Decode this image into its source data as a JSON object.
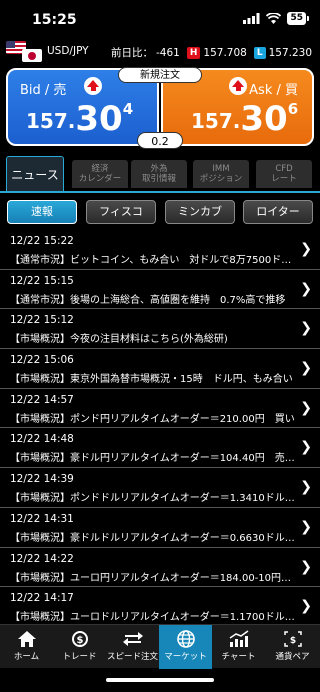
{
  "status": {
    "time": "15:25",
    "battery": "55"
  },
  "pair": {
    "name": "USD/JPY",
    "change_label": "前日比：",
    "change_value": "-461",
    "high_badge": "H",
    "high": "157.708",
    "low_badge": "L",
    "low": "157.230"
  },
  "bid": {
    "label": "Bid / 売",
    "prefix": "157.",
    "main": "30",
    "last": "4"
  },
  "ask": {
    "label": "Ask / 買",
    "prefix": "157.",
    "main": "30",
    "last": "6"
  },
  "new_order": "新規注文",
  "spread": "0.2",
  "tabs": [
    {
      "line1": "ニュース",
      "line2": ""
    },
    {
      "line1": "経済",
      "line2": "カレンダー"
    },
    {
      "line1": "外為",
      "line2": "取引情報"
    },
    {
      "line1": "IMM",
      "line2": "ポジション"
    },
    {
      "line1": "CFD",
      "line2": "レート"
    }
  ],
  "filters": [
    "速報",
    "フィスコ",
    "ミンカブ",
    "ロイター"
  ],
  "news": [
    {
      "date": "12/22 15:22",
      "title": "【通常市況】ビットコイン、もみ合い　対ドルで8万7500ドル…"
    },
    {
      "date": "12/22 15:15",
      "title": "【通常市況】後場の上海総合、高値圏を維持　0.7%高で推移"
    },
    {
      "date": "12/22 15:12",
      "title": "【市場概況】今夜の注目材料はこちら(外為総研)"
    },
    {
      "date": "12/22 15:06",
      "title": "【市場概況】東京外国為替市場概況・15時　ドル円、もみ合い"
    },
    {
      "date": "12/22 14:57",
      "title": "【市場概況】ポンド円リアルタイムオーダー＝210.00円　買い"
    },
    {
      "date": "12/22 14:48",
      "title": "【市場概況】豪ドル円リアルタイムオーダー＝104.40円　売り…"
    },
    {
      "date": "12/22 14:39",
      "title": "【市場概況】ポンドドルリアルタイムオーダー＝1.3410ドル　売り"
    },
    {
      "date": "12/22 14:31",
      "title": "【市場概況】豪ドルドルリアルタイムオーダー＝0.6630ドル　売り"
    },
    {
      "date": "12/22 14:22",
      "title": "【市場概況】ユーロ円リアルタイムオーダー＝184.00-10円…"
    },
    {
      "date": "12/22 14:17",
      "title": "【市場概況】ユーロドルリアルタイムオーダー＝1.1700ドル　買い…"
    }
  ],
  "nav": [
    {
      "label": "ホーム",
      "icon": "home-icon"
    },
    {
      "label": "トレード",
      "icon": "trade-icon"
    },
    {
      "label": "スピード注文",
      "icon": "speed-order-icon"
    },
    {
      "label": "マーケット",
      "icon": "globe-icon"
    },
    {
      "label": "チャート",
      "icon": "chart-icon"
    },
    {
      "label": "通貨ペア",
      "icon": "currency-pair-icon"
    }
  ],
  "colors": {
    "bid": "#1c5fcf",
    "ask": "#e86b0c",
    "accent": "#2aa8d8",
    "high": "#e0101a",
    "low": "#19a6e0"
  }
}
